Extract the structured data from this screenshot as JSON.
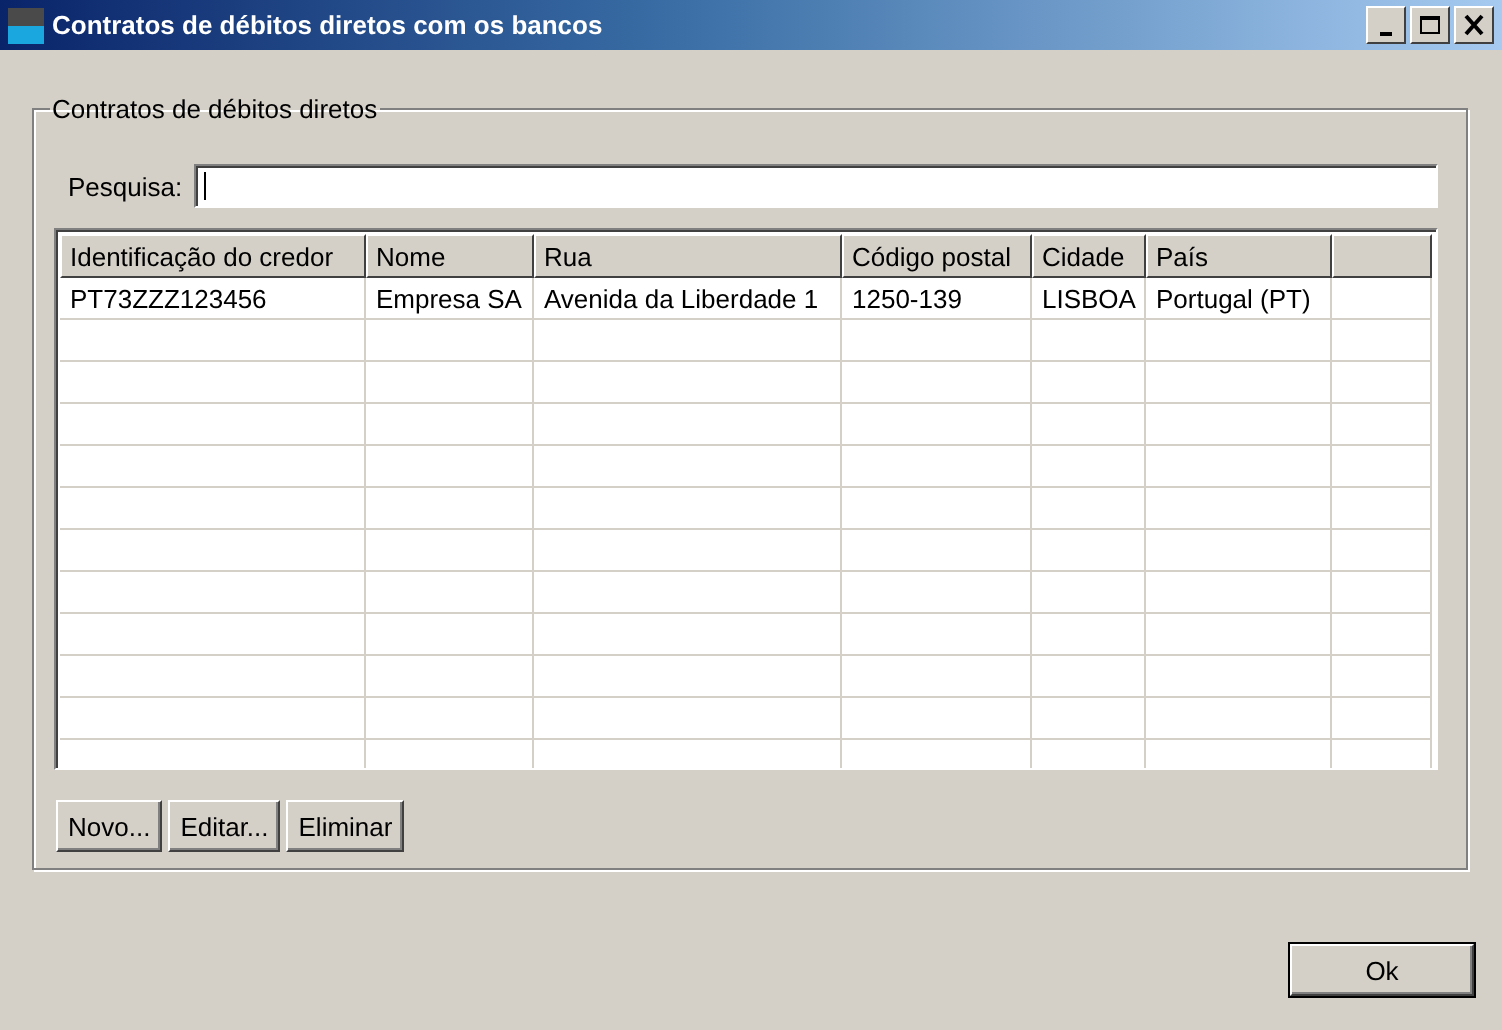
{
  "window": {
    "title": "Contratos de débitos diretos com os bancos"
  },
  "group": {
    "title": "Contratos de débitos diretos"
  },
  "search": {
    "label": "Pesquisa:",
    "focused": true
  },
  "table": {
    "columns": [
      "Identificação do credor",
      "Nome",
      "Rua",
      "Código postal",
      "Cidade",
      "País"
    ],
    "rows": [
      [
        "PT73ZZZ123456",
        "Empresa SA",
        "Avenida da Liberdade 1",
        "1250-139",
        "LISBOA",
        "Portugal (PT)"
      ]
    ]
  },
  "buttons": [
    "Novo...",
    "Editar...",
    "Eliminar"
  ],
  "dialog_buttons": [
    {
      "label": "Ok",
      "default": true
    }
  ]
}
